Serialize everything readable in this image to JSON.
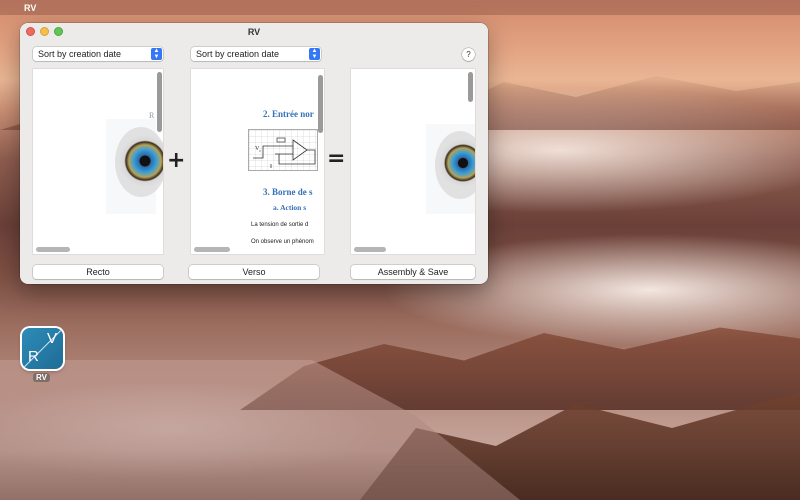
{
  "menubar": {
    "apple_icon": "",
    "app_name": "RV"
  },
  "window": {
    "title": "RV"
  },
  "sort": {
    "left_value": "Sort by creation date",
    "middle_value": "Sort by creation date"
  },
  "help_label": "?",
  "operators": {
    "plus": "+",
    "equals": "="
  },
  "verso_doc": {
    "heading_2": "2.  Entrée nor",
    "heading_3": "3.  Borne de s",
    "heading_a": "a.   Action s",
    "line_1": "La tension de sortie d",
    "line_2": "On observe un phénom",
    "vc_label": "V",
    "vc_sub": "c"
  },
  "recto_doc": {
    "letter": "R"
  },
  "buttons": {
    "recto": "Recto",
    "verso": "Verso",
    "assembly": "Assembly & Save"
  },
  "desktop_icon": {
    "letter_r": "R",
    "letter_v": "V",
    "label": "RV"
  }
}
